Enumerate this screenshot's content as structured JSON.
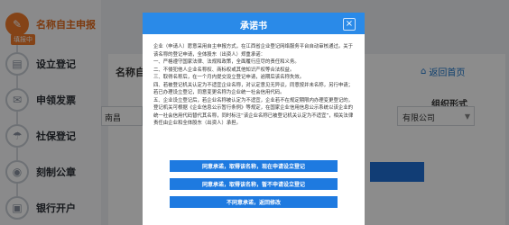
{
  "sidebar": {
    "items": [
      {
        "label": "名称自主申报",
        "glyph": "✎",
        "active": true
      },
      {
        "label": "设立登记",
        "glyph": "▤",
        "active": false
      },
      {
        "label": "申领发票",
        "glyph": "✉",
        "active": false
      },
      {
        "label": "社保登记",
        "glyph": "☂",
        "active": false
      },
      {
        "label": "刻制公章",
        "glyph": "◉",
        "active": false
      },
      {
        "label": "银行开户",
        "glyph": "▣",
        "active": false
      }
    ],
    "badge": "填报中"
  },
  "main": {
    "title": "名称自主",
    "back_label": "返回首页",
    "org_label": "组织形式",
    "left_field_value": "南昌",
    "right_field_value": "有限公司"
  },
  "modal": {
    "title": "承诺书",
    "close_symbol": "×",
    "paragraphs": [
      "企业（申请人）愿意采用自主申报方式，在江西省企业登记网络服务平台自动审核通过。关于该名称的登记申请，全体股东（出资人）郑重承诺：",
      "一、严格遵守国家法律、法规和政策，全面履行应尽的责任和义务。",
      "二、不侵犯他人企业名称权、商标权或其他知识产权等合法权益。",
      "三、取得名称后，在一个月内提交设立登记申请，逾期后该名称失效。",
      "四、若被登记机关认定为不适宜企业名称，对认定意见无异议，同意按并未名称，另行申请；若已办理设立登记，同意变更名称为企业统一社会信用代码。",
      "五、企业设立登记后，若企业名称被认定为不适宜，企业若不在规定期限内办理变更登记的，登记机关可根据《企业信息公示暂行条例》等规定，在国家企业信用信息公示系统以该企业的统一社会信用代码替代其名称，同时标注“该企业名称已被登记机关认定为不适宜”，相关法律责任由企业和全体股东（出资人）承担。"
    ],
    "buttons": [
      "同意承诺，取得该名称，现在申请设立登记",
      "同意承诺，取得该名称，暂不申请设立登记",
      "不同意承诺，返回修改"
    ]
  },
  "colors": {
    "accent": "#2a8ae8",
    "button": "#1e7ae0",
    "active_step": "#f07a2a"
  }
}
